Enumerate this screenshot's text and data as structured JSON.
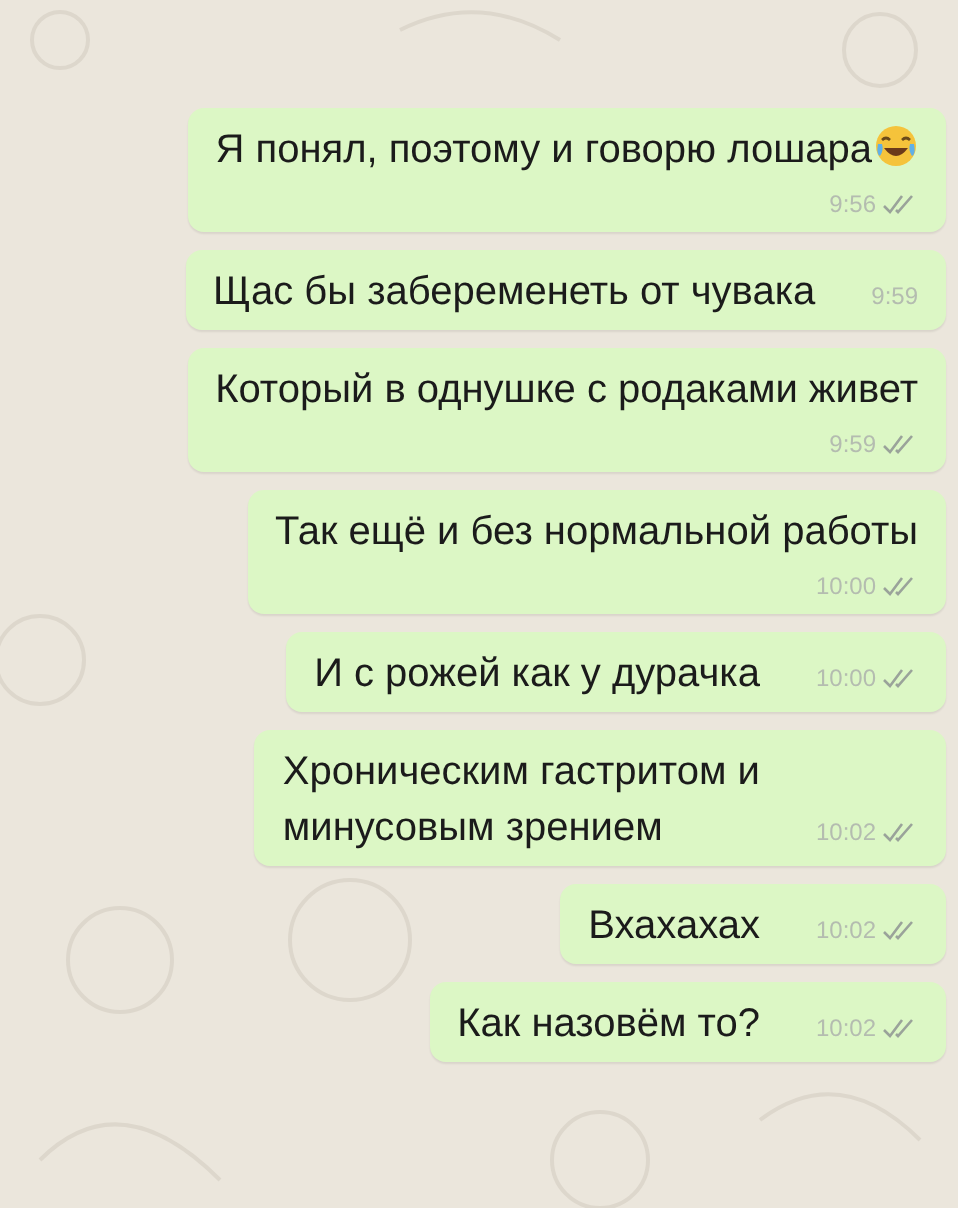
{
  "messages": [
    {
      "text": "Я понял, поэтому и говорю лошара",
      "laughing_emoji": true,
      "time": "9:56",
      "ticks": true,
      "kind": "stacked"
    },
    {
      "text": "Щас бы забеременеть от чувака",
      "time": "9:59",
      "ticks": false,
      "kind": "inline"
    },
    {
      "text": "Который в однушке с  родаками живет",
      "time": "9:59",
      "ticks": true,
      "kind": "stacked"
    },
    {
      "text": "Так ещё и без нормальной работы",
      "time": "10:00",
      "ticks": true,
      "kind": "stacked"
    },
    {
      "text": "И с рожей как у дурачка",
      "time": "10:00",
      "ticks": true,
      "kind": "inline"
    },
    {
      "text": "Хроническим гастритом и\nминусовым зрением",
      "time": "10:02",
      "ticks": true,
      "kind": "inline"
    },
    {
      "text": "Вхахахах",
      "time": "10:02",
      "ticks": true,
      "kind": "inline"
    },
    {
      "text": "Как назовём то?",
      "time": "10:02",
      "ticks": true,
      "kind": "inline"
    }
  ]
}
